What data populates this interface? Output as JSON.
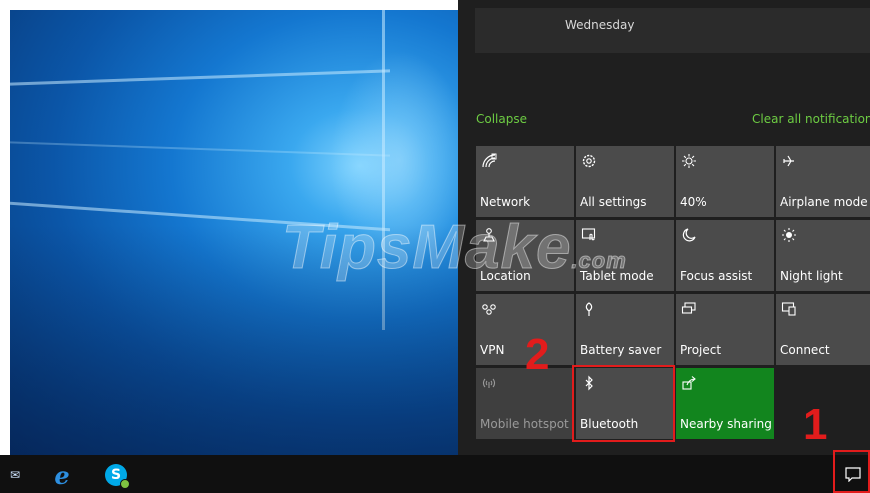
{
  "action_center": {
    "date_label": "Wednesday",
    "collapse_label": "Collapse",
    "clear_label": "Clear all notifications",
    "tiles": [
      {
        "label": "Network",
        "icon": "network-icon",
        "state": "off"
      },
      {
        "label": "All settings",
        "icon": "gear-icon",
        "state": "off"
      },
      {
        "label": "40%",
        "icon": "brightness-icon",
        "state": "off"
      },
      {
        "label": "Airplane mode",
        "icon": "airplane-icon",
        "state": "off"
      },
      {
        "label": "Location",
        "icon": "location-icon",
        "state": "off"
      },
      {
        "label": "Tablet mode",
        "icon": "tablet-mode-icon",
        "state": "off"
      },
      {
        "label": "Focus assist",
        "icon": "moon-icon",
        "state": "off"
      },
      {
        "label": "Night light",
        "icon": "night-light-icon",
        "state": "off"
      },
      {
        "label": "VPN",
        "icon": "vpn-icon",
        "state": "off"
      },
      {
        "label": "Battery saver",
        "icon": "battery-saver-icon",
        "state": "off"
      },
      {
        "label": "Project",
        "icon": "project-icon",
        "state": "off"
      },
      {
        "label": "Connect",
        "icon": "connect-icon",
        "state": "off"
      },
      {
        "label": "Mobile hotspot",
        "icon": "hotspot-icon",
        "state": "disabled"
      },
      {
        "label": "Bluetooth",
        "icon": "bluetooth-icon",
        "state": "off"
      },
      {
        "label": "Nearby sharing",
        "icon": "nearby-sharing-icon",
        "state": "on"
      }
    ]
  },
  "annotations": {
    "step1": "1",
    "step2": "2",
    "color": "#e21c1c"
  },
  "watermark": "TipsMake",
  "watermark_suffix": ".com",
  "taskbar": {
    "icons": [
      "mail-icon",
      "internet-explorer-icon",
      "skype-icon"
    ],
    "notification_button": "action-center-icon"
  },
  "colors": {
    "accent_green": "#6dcc43",
    "tile_on": "#12851e",
    "tile_off": "#4b4b4b",
    "panel_bg": "#1f1f1f"
  }
}
